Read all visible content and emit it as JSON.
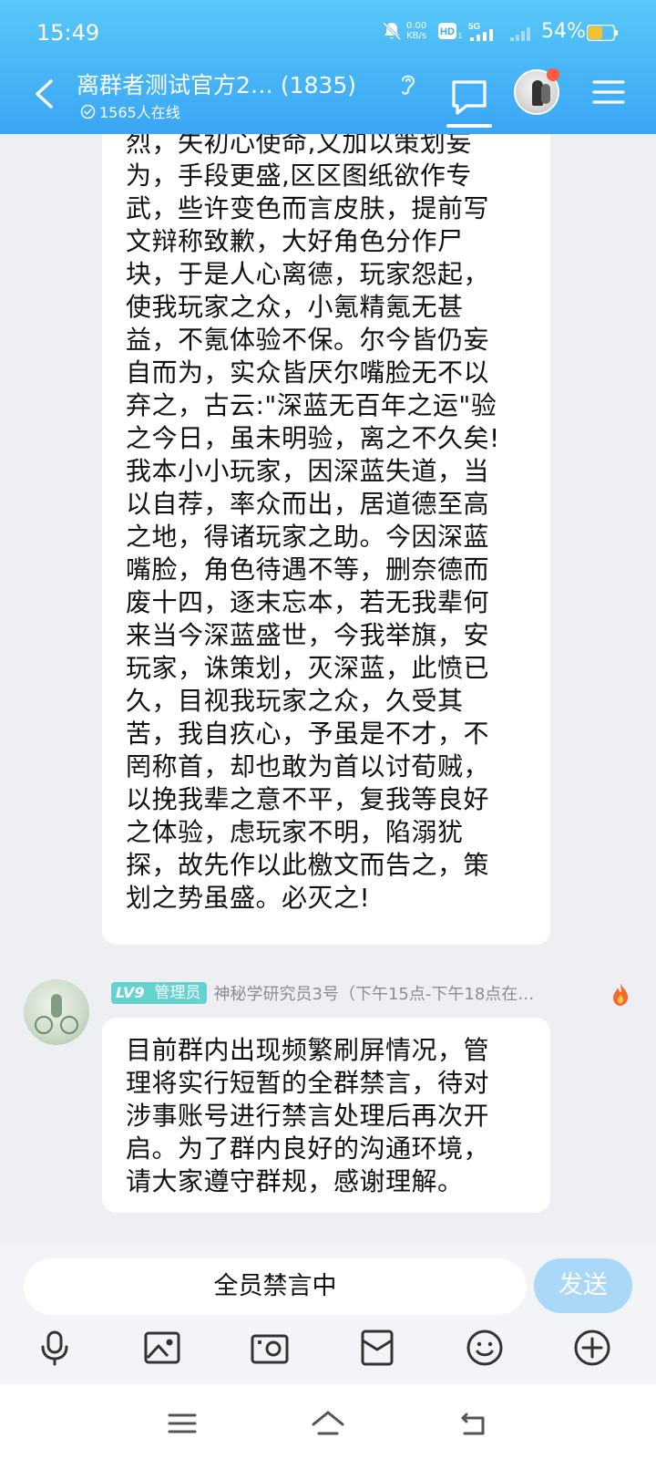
{
  "status_bar": {
    "time": "15:49",
    "net_speed_value": "0.00",
    "net_speed_unit": "KB/s",
    "hd_label": "HD",
    "hd_sub": "1",
    "network_label": "5G",
    "battery_percent": "54%",
    "battery_level": 0.54,
    "icons": [
      "bell-off-icon",
      "hd-icon",
      "signal-icon",
      "battery-icon"
    ]
  },
  "titlebar": {
    "title": "离群者测试官方2… (1835)",
    "online_count": "1565人在线",
    "icons": [
      "back-icon",
      "ear-icon",
      "chat-bubble-icon",
      "avatar",
      "menu-icon"
    ]
  },
  "messages": [
    {
      "text": "烈，失初心使命,又加以策划妄\n为，手段更盛,区区图纸欲作专\n武，些许变色而言皮肤，提前写\n文辩称致歉，大好角色分作尸\n块，于是人心离德，玩家怨起，\n使我玩家之众，小氪精氪无甚\n益，不氪体验不保。尔今皆仍妄\n自而为，实众皆厌尔嘴脸无不以\n弃之，古云:\"深蓝无百年之运\"验\n之今日，虽未明验，离之不久矣!\n我本小小玩家，因深蓝失道，当\n以自荐，率众而出，居道德至高\n之地，得诸玩家之助。今因深蓝\n嘴脸，角色待遇不等，删奈德而\n废十四，逐末忘本，若无我辈何\n来当今深蓝盛世，今我举旗，安\n玩家，诛策划，灭深蓝，此愤已\n久，目视我玩家之众，久受其\n苦，我自疚心，予虽是不才，不\n罔称首，却也敢为首以讨荀贼，\n以挽我辈之意不平，复我等良好\n之体验，虑玩家不明，陷溺犹\n探，故先作以此檄文而告之，策\n划之势虽盛。必灭之!"
    },
    {
      "sender_level": "LV9",
      "sender_role": "管理员",
      "sender_name": "神秘学研究员3号（下午15点-下午18点在…",
      "text": "目前群内出现频繁刷屏情况，管\n理将实行短暂的全群禁言，待对\n涉事账号进行禁言处理后再次开\n启。为了群内良好的沟通环境，\n请大家遵守群规，感谢理解。"
    }
  ],
  "input": {
    "value": "全员禁言中",
    "send_label": "发送"
  },
  "toolbar": [
    "microphone-icon",
    "image-icon",
    "camera-icon",
    "red-packet-icon",
    "emoji-icon",
    "plus-icon"
  ],
  "navbar": [
    "menu-nav-icon",
    "home-nav-icon",
    "back-nav-icon"
  ],
  "colors": {
    "header_top": "#58c8f8",
    "header_bottom": "#3aa6f5",
    "chat_background": "#eeeff3",
    "send_button": "#a9d8f8",
    "level_badge": "#64d3cf",
    "battery_fill": "#f5c02d"
  }
}
